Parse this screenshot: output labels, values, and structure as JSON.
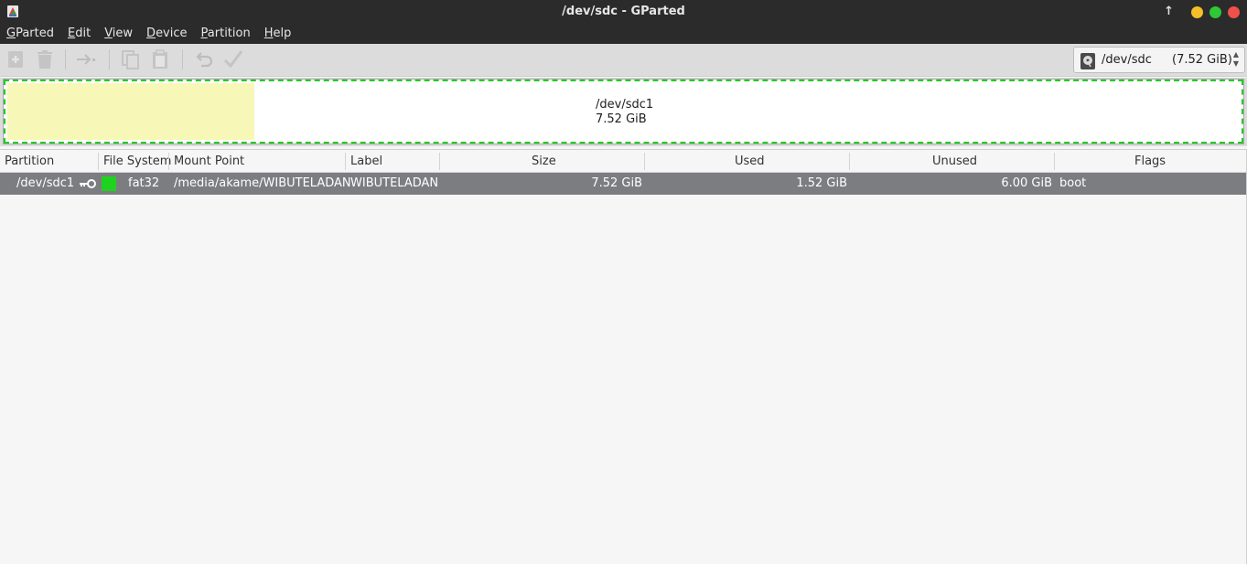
{
  "window": {
    "title": "/dev/sdc - GParted",
    "controls": {
      "up_arrow": "↑",
      "minimize_color": "#f5bf2a",
      "maximize_color": "#2ec735",
      "close_color": "#f0504c"
    }
  },
  "menubar": {
    "items": [
      {
        "acc": "G",
        "rest": "Parted"
      },
      {
        "acc": "E",
        "rest": "dit"
      },
      {
        "acc": "V",
        "rest": "iew"
      },
      {
        "acc": "D",
        "rest": "evice"
      },
      {
        "acc": "P",
        "rest": "artition"
      },
      {
        "acc": "H",
        "rest": "elp"
      }
    ]
  },
  "toolbar": {
    "buttons": [
      "new-icon",
      "delete-icon",
      "resize-move-icon",
      "copy-icon",
      "paste-icon",
      "undo-icon",
      "apply-icon"
    ]
  },
  "device_selector": {
    "name": "/dev/sdc",
    "size": "(7.52 GiB)",
    "icon": "disk-icon"
  },
  "graph": {
    "partition": "/dev/sdc1",
    "size": "7.52 GiB",
    "used_fraction": 0.2,
    "used_color": "#f7f7b8",
    "border_color": "#22cc22"
  },
  "table": {
    "headers": {
      "partition": "Partition",
      "filesystem": "File System",
      "mountpoint": "Mount Point",
      "label": "Label",
      "size": "Size",
      "used": "Used",
      "unused": "Unused",
      "flags": "Flags"
    },
    "rows": [
      {
        "partition": "/dev/sdc1",
        "filesystem": "fat32",
        "fs_color": "#1fd21f",
        "mountpoint": "/media/akame/WIBUTELADAN",
        "label": "WIBUTELADAN",
        "size": "7.52 GiB",
        "used": "1.52 GiB",
        "unused": "6.00 GiB",
        "flags": "boot",
        "mounted_icon": "key-icon"
      }
    ]
  }
}
